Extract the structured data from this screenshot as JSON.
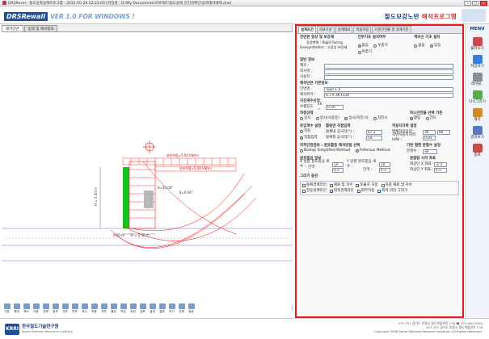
{
  "window": {
    "title": "DRSRevel : 철도옹벽설계프로그램 - 2012-05-28 12:23:00 [파일명 : D:\\My Documents\\프로젝트\\철도옹벽 안전성확인\\옹벽해석예제.drw]"
  },
  "header": {
    "logo_text": "DRSRewall",
    "version_text": "VER 1.0 FOR WINDOWS !",
    "brand_prefix": "철도보강노반 ",
    "brand_suffix": "해석프로그램"
  },
  "left_tabs": [
    "해석단면",
    "입력 및 해석결과"
  ],
  "drawing": {
    "load1": "분포하중=5.00 kN/m²",
    "load2": "분포하중=5.00 kN/m²",
    "dim_h": "H = 5.00 m",
    "dim_b": "B = 2.50 m",
    "dim_toe": "0.50 m",
    "angle1": "θ=30.00°",
    "angle2": "β=0.00°"
  },
  "toolbar": [
    "기본",
    "확대",
    "축소",
    "이동",
    "전체",
    "점보",
    "선보",
    "면보",
    "치수",
    "하중",
    "지반",
    "물성",
    "보강",
    "속성",
    "검토",
    "설정",
    "결과",
    "보기",
    "인쇄",
    "종료"
  ],
  "right_tabs": [
    "설계조건",
    "지표구성",
    "설계재료",
    "작용하중",
    "기준안전률 및 설계기준"
  ],
  "panel": {
    "cross_section": {
      "title": "전면판 형상 및 보강재",
      "facing": "강성벽체 : Rigid Facing",
      "geosynth": "Geosynthetics : 고강성 보강재"
    },
    "ground_detail": {
      "title": "전부기초 설치여부",
      "options": [
        "없음",
        "우층기",
        "비층기"
      ],
      "selected": 0
    },
    "key": {
      "title": "케이슨 기초 설치",
      "options": [
        "없음",
        "있음"
      ],
      "selected": 1
    },
    "general": {
      "title": "일반 정보",
      "rows": [
        {
          "label": "제목 :",
          "value": ""
        },
        {
          "label": "회사명 :",
          "value": ""
        },
        {
          "label": "사용자 :",
          "value": ""
        }
      ]
    },
    "section_info": {
      "title": "해석단면 기본정보",
      "rows": [
        {
          "label": "단면명 :",
          "value": "Type 1-4"
        },
        {
          "label": "해석위치 :",
          "value": "S.T.A 3K+120"
        }
      ]
    },
    "seismic": {
      "title": "지진계수산정",
      "label": "수평진도",
      "kh_label": "kh =",
      "value": "0.20"
    },
    "load_case": {
      "title": "하중상태",
      "options": [
        "상시",
        "일시(사용중)",
        "일시(지진시)",
        "지진시"
      ],
      "selected": 2
    },
    "min_safety": {
      "title": "최소안전율 선택 기준",
      "options": [
        "활동",
        "전도"
      ],
      "selected": 0
    },
    "pressure": {
      "title": "토압계수 설정",
      "options": [
        "자동",
        "직접입력"
      ],
      "selected": 1,
      "coef_title": "활동면 직접입력",
      "coef_rows": [
        {
          "label": "블록내 공극각(°) :",
          "value": "47.2"
        },
        {
          "label": "블록외 공극각(°) :",
          "value": "54"
        }
      ]
    },
    "allowable": {
      "title": "허용지지력 설정",
      "rows": [
        {
          "label": "벽체허용응력 :",
          "v1": "36",
          "v2": "86"
        },
        {
          "label": "지반허용지지력(kN) :",
          "v1": "0.05",
          "v2": ""
        }
      ]
    },
    "stability": {
      "title": "외적안정검토 : 원호활동 해석방법 선택",
      "options": [
        "Bishop Simplified Method",
        "Fellenius Method"
      ],
      "selected": 1
    },
    "circle_split": {
      "title": "기본 절편 분할수 설정",
      "label": "분할수 :",
      "value": "30"
    },
    "center": {
      "title": "원호중심 정보",
      "x_label": "X 방향 원호중심 개수 :",
      "x_val": "10",
      "y_label": "Y 방향 원호중심 개수 :",
      "y_val": "10",
      "int_label1": "간격 :",
      "int_val1": "0.5",
      "int_label2": "간격 :",
      "int_val2": "0.5"
    },
    "start": {
      "title": "원점탐 시작 좌표",
      "rows": [
        {
          "label": "좌상단 X 좌표 :",
          "value": "-2.5"
        },
        {
          "label": "좌상단 Y 좌표 :",
          "value": "4.5"
        }
      ]
    },
    "draw_opts": {
      "title": "그리기 옵션",
      "row1": [
        {
          "label": "블록경계라인",
          "on": true
        },
        {
          "label": "재료 및 치수",
          "on": true
        },
        {
          "label": "토불포 하중",
          "on": true
        },
        {
          "label": "하중 재료 및 치수",
          "on": true
        }
      ],
      "row2": [
        {
          "label": "전응설계라인",
          "on": true
        },
        {
          "label": "외적경계라인",
          "on": true
        },
        {
          "label": "외부하중",
          "on": true
        },
        {
          "label": "외곽 라인 그리기",
          "on": true
        }
      ]
    }
  },
  "menu": {
    "title": "MENU",
    "items": [
      {
        "label": "불러오기",
        "color": "#c94a4a"
      },
      {
        "label": "저장하기",
        "color": "#3a7fd5"
      },
      {
        "label": "레이블..",
        "color": "#8c8c8c"
      },
      {
        "label": "다시그리기",
        "color": "#5ba84d"
      },
      {
        "label": "해석",
        "color": "#d08a2a"
      },
      {
        "label": "결과보기",
        "color": "#5a7ab8"
      },
      {
        "label": "종료",
        "color": "#c94a4a"
      }
    ]
  },
  "footer": {
    "org_mark": "KRRI",
    "org_name": "한국철도기술연구원",
    "org_en": "Korea Railroad Research Institute",
    "addr1": "437-757 경기도 의왕시 철도박물관로 176 ☎ 031)460-5000",
    "addr2": "437-757 경기도 의왕시 철도박물관로 176",
    "copyright": "Copyright 2008 Korea Railroad Research Institute. All Rights Reserved."
  }
}
